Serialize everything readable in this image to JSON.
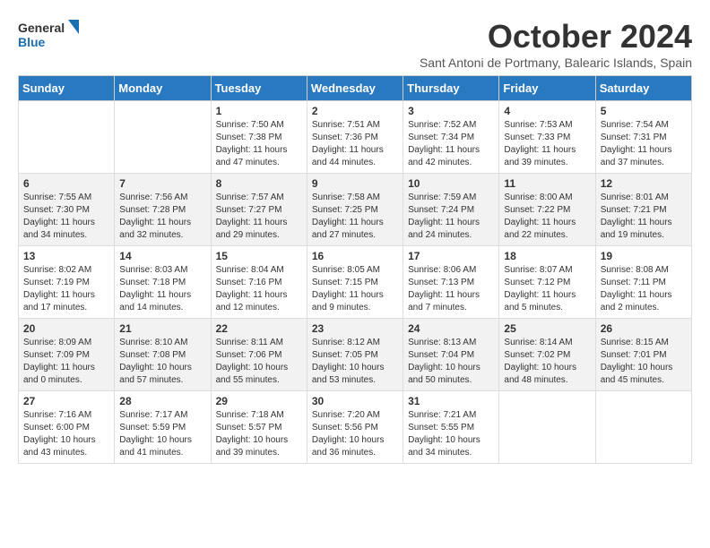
{
  "header": {
    "logo_line1": "General",
    "logo_line2": "Blue",
    "month_title": "October 2024",
    "subtitle": "Sant Antoni de Portmany, Balearic Islands, Spain"
  },
  "weekdays": [
    "Sunday",
    "Monday",
    "Tuesday",
    "Wednesday",
    "Thursday",
    "Friday",
    "Saturday"
  ],
  "weeks": [
    [
      {
        "day": null,
        "info": ""
      },
      {
        "day": null,
        "info": ""
      },
      {
        "day": "1",
        "info": "Sunrise: 7:50 AM\nSunset: 7:38 PM\nDaylight: 11 hours and 47 minutes."
      },
      {
        "day": "2",
        "info": "Sunrise: 7:51 AM\nSunset: 7:36 PM\nDaylight: 11 hours and 44 minutes."
      },
      {
        "day": "3",
        "info": "Sunrise: 7:52 AM\nSunset: 7:34 PM\nDaylight: 11 hours and 42 minutes."
      },
      {
        "day": "4",
        "info": "Sunrise: 7:53 AM\nSunset: 7:33 PM\nDaylight: 11 hours and 39 minutes."
      },
      {
        "day": "5",
        "info": "Sunrise: 7:54 AM\nSunset: 7:31 PM\nDaylight: 11 hours and 37 minutes."
      }
    ],
    [
      {
        "day": "6",
        "info": "Sunrise: 7:55 AM\nSunset: 7:30 PM\nDaylight: 11 hours and 34 minutes."
      },
      {
        "day": "7",
        "info": "Sunrise: 7:56 AM\nSunset: 7:28 PM\nDaylight: 11 hours and 32 minutes."
      },
      {
        "day": "8",
        "info": "Sunrise: 7:57 AM\nSunset: 7:27 PM\nDaylight: 11 hours and 29 minutes."
      },
      {
        "day": "9",
        "info": "Sunrise: 7:58 AM\nSunset: 7:25 PM\nDaylight: 11 hours and 27 minutes."
      },
      {
        "day": "10",
        "info": "Sunrise: 7:59 AM\nSunset: 7:24 PM\nDaylight: 11 hours and 24 minutes."
      },
      {
        "day": "11",
        "info": "Sunrise: 8:00 AM\nSunset: 7:22 PM\nDaylight: 11 hours and 22 minutes."
      },
      {
        "day": "12",
        "info": "Sunrise: 8:01 AM\nSunset: 7:21 PM\nDaylight: 11 hours and 19 minutes."
      }
    ],
    [
      {
        "day": "13",
        "info": "Sunrise: 8:02 AM\nSunset: 7:19 PM\nDaylight: 11 hours and 17 minutes."
      },
      {
        "day": "14",
        "info": "Sunrise: 8:03 AM\nSunset: 7:18 PM\nDaylight: 11 hours and 14 minutes."
      },
      {
        "day": "15",
        "info": "Sunrise: 8:04 AM\nSunset: 7:16 PM\nDaylight: 11 hours and 12 minutes."
      },
      {
        "day": "16",
        "info": "Sunrise: 8:05 AM\nSunset: 7:15 PM\nDaylight: 11 hours and 9 minutes."
      },
      {
        "day": "17",
        "info": "Sunrise: 8:06 AM\nSunset: 7:13 PM\nDaylight: 11 hours and 7 minutes."
      },
      {
        "day": "18",
        "info": "Sunrise: 8:07 AM\nSunset: 7:12 PM\nDaylight: 11 hours and 5 minutes."
      },
      {
        "day": "19",
        "info": "Sunrise: 8:08 AM\nSunset: 7:11 PM\nDaylight: 11 hours and 2 minutes."
      }
    ],
    [
      {
        "day": "20",
        "info": "Sunrise: 8:09 AM\nSunset: 7:09 PM\nDaylight: 11 hours and 0 minutes."
      },
      {
        "day": "21",
        "info": "Sunrise: 8:10 AM\nSunset: 7:08 PM\nDaylight: 10 hours and 57 minutes."
      },
      {
        "day": "22",
        "info": "Sunrise: 8:11 AM\nSunset: 7:06 PM\nDaylight: 10 hours and 55 minutes."
      },
      {
        "day": "23",
        "info": "Sunrise: 8:12 AM\nSunset: 7:05 PM\nDaylight: 10 hours and 53 minutes."
      },
      {
        "day": "24",
        "info": "Sunrise: 8:13 AM\nSunset: 7:04 PM\nDaylight: 10 hours and 50 minutes."
      },
      {
        "day": "25",
        "info": "Sunrise: 8:14 AM\nSunset: 7:02 PM\nDaylight: 10 hours and 48 minutes."
      },
      {
        "day": "26",
        "info": "Sunrise: 8:15 AM\nSunset: 7:01 PM\nDaylight: 10 hours and 45 minutes."
      }
    ],
    [
      {
        "day": "27",
        "info": "Sunrise: 7:16 AM\nSunset: 6:00 PM\nDaylight: 10 hours and 43 minutes."
      },
      {
        "day": "28",
        "info": "Sunrise: 7:17 AM\nSunset: 5:59 PM\nDaylight: 10 hours and 41 minutes."
      },
      {
        "day": "29",
        "info": "Sunrise: 7:18 AM\nSunset: 5:57 PM\nDaylight: 10 hours and 39 minutes."
      },
      {
        "day": "30",
        "info": "Sunrise: 7:20 AM\nSunset: 5:56 PM\nDaylight: 10 hours and 36 minutes."
      },
      {
        "day": "31",
        "info": "Sunrise: 7:21 AM\nSunset: 5:55 PM\nDaylight: 10 hours and 34 minutes."
      },
      {
        "day": null,
        "info": ""
      },
      {
        "day": null,
        "info": ""
      }
    ]
  ]
}
